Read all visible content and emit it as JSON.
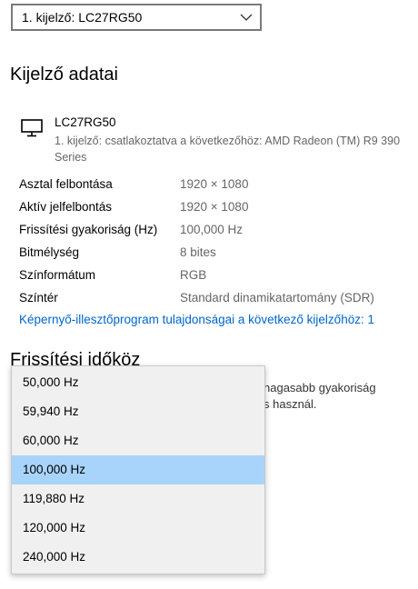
{
  "display_selector": {
    "value": "1. kijelző: LC27RG50"
  },
  "section_display_info": {
    "title": "Kijelző adatai"
  },
  "monitor": {
    "name": "LC27RG50",
    "description": "1. kijelző: csatlakoztatva a következőhöz: AMD Radeon (TM) R9 390 Series"
  },
  "info_rows": [
    {
      "label": "Asztal felbontása",
      "value": "1920 × 1080"
    },
    {
      "label": "Aktív jelfelbontás",
      "value": "1920 × 1080"
    },
    {
      "label": "Frissítési gyakoriság (Hz)",
      "value": "100,000 Hz"
    },
    {
      "label": "Bitmélység",
      "value": "8 bites"
    },
    {
      "label": "Színformátum",
      "value": "RGB"
    },
    {
      "label": "Színtér",
      "value": "Standard dinamikatartomány (SDR)"
    }
  ],
  "adapter_link": "Képernyő-illesztőprogram tulajdonságai a következő kijelzőhöz: 1",
  "section_refresh": {
    "title": "Frissítési időköz"
  },
  "background_text": {
    "line1": "nagasabb gyakoriság",
    "line2": "s használ."
  },
  "refresh_options": [
    {
      "label": "50,000 Hz"
    },
    {
      "label": "59,940 Hz"
    },
    {
      "label": "60,000 Hz"
    },
    {
      "label": "100,000 Hz",
      "selected": true
    },
    {
      "label": "119,880 Hz"
    },
    {
      "label": "120,000 Hz"
    },
    {
      "label": "240,000 Hz"
    }
  ],
  "colors": {
    "link": "#0066cc",
    "selected_option": "#a8d4fb",
    "secondary_text": "#666666"
  }
}
